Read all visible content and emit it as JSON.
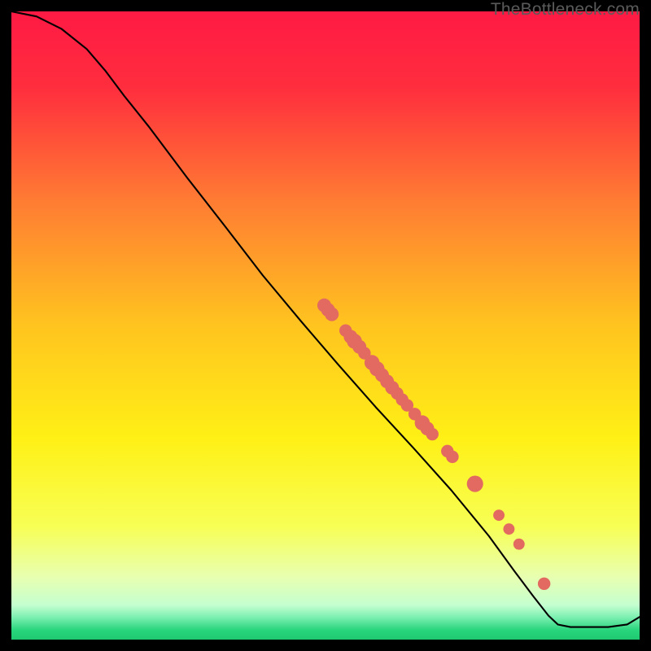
{
  "watermark": "TheBottleneck.com",
  "chart_data": {
    "type": "line",
    "title": "",
    "xlabel": "",
    "ylabel": "",
    "xlim": [
      0,
      100
    ],
    "ylim": [
      0,
      100
    ],
    "gradient_stops": [
      {
        "offset": 0.0,
        "color": "#ff1a44"
      },
      {
        "offset": 0.12,
        "color": "#ff2d3e"
      },
      {
        "offset": 0.3,
        "color": "#ff7b33"
      },
      {
        "offset": 0.5,
        "color": "#ffc41f"
      },
      {
        "offset": 0.68,
        "color": "#fff016"
      },
      {
        "offset": 0.82,
        "color": "#f7ff55"
      },
      {
        "offset": 0.9,
        "color": "#e8ffb0"
      },
      {
        "offset": 0.945,
        "color": "#c5ffd0"
      },
      {
        "offset": 0.965,
        "color": "#7aefb0"
      },
      {
        "offset": 0.985,
        "color": "#28d47c"
      },
      {
        "offset": 1.0,
        "color": "#1ec972"
      }
    ],
    "curve": [
      {
        "x": 0,
        "y": 100
      },
      {
        "x": 4,
        "y": 99.2
      },
      {
        "x": 8,
        "y": 97.2
      },
      {
        "x": 12,
        "y": 94
      },
      {
        "x": 15,
        "y": 90.5
      },
      {
        "x": 18,
        "y": 86.5
      },
      {
        "x": 22,
        "y": 81.5
      },
      {
        "x": 28,
        "y": 73.5
      },
      {
        "x": 34,
        "y": 65.8
      },
      {
        "x": 40,
        "y": 58
      },
      {
        "x": 46,
        "y": 50.8
      },
      {
        "x": 52,
        "y": 43.8
      },
      {
        "x": 58,
        "y": 37.0
      },
      {
        "x": 64,
        "y": 30.5
      },
      {
        "x": 70,
        "y": 23.8
      },
      {
        "x": 76,
        "y": 16.5
      },
      {
        "x": 80,
        "y": 11.0
      },
      {
        "x": 83,
        "y": 7.0
      },
      {
        "x": 85.5,
        "y": 3.8
      },
      {
        "x": 87,
        "y": 2.4
      },
      {
        "x": 89,
        "y": 2.0
      },
      {
        "x": 95,
        "y": 2.0
      },
      {
        "x": 98,
        "y": 2.4
      },
      {
        "x": 100,
        "y": 3.6
      }
    ],
    "markers": [
      {
        "x": 49.8,
        "y": 53.2,
        "r": 1.1
      },
      {
        "x": 50.4,
        "y": 52.5,
        "r": 1.1
      },
      {
        "x": 51.0,
        "y": 51.8,
        "r": 1.1
      },
      {
        "x": 53.2,
        "y": 49.2,
        "r": 1.0
      },
      {
        "x": 54.0,
        "y": 48.2,
        "r": 1.1
      },
      {
        "x": 54.6,
        "y": 47.5,
        "r": 1.2
      },
      {
        "x": 55.4,
        "y": 46.6,
        "r": 1.1
      },
      {
        "x": 56.2,
        "y": 45.6,
        "r": 1.0
      },
      {
        "x": 57.4,
        "y": 44.1,
        "r": 1.2
      },
      {
        "x": 58.2,
        "y": 43.1,
        "r": 1.2
      },
      {
        "x": 59.0,
        "y": 42.1,
        "r": 1.1
      },
      {
        "x": 59.8,
        "y": 41.1,
        "r": 1.1
      },
      {
        "x": 60.6,
        "y": 40.1,
        "r": 1.1
      },
      {
        "x": 61.4,
        "y": 39.2,
        "r": 1.0
      },
      {
        "x": 62.2,
        "y": 38.2,
        "r": 1.0
      },
      {
        "x": 63.0,
        "y": 37.3,
        "r": 1.0
      },
      {
        "x": 64.2,
        "y": 35.9,
        "r": 1.0
      },
      {
        "x": 65.4,
        "y": 34.5,
        "r": 1.2
      },
      {
        "x": 66.2,
        "y": 33.6,
        "r": 1.1
      },
      {
        "x": 67.0,
        "y": 32.7,
        "r": 1.0
      },
      {
        "x": 69.4,
        "y": 30.0,
        "r": 1.0
      },
      {
        "x": 70.2,
        "y": 29.1,
        "r": 1.0
      },
      {
        "x": 73.8,
        "y": 24.8,
        "r": 1.3
      },
      {
        "x": 77.6,
        "y": 19.8,
        "r": 0.9
      },
      {
        "x": 79.2,
        "y": 17.6,
        "r": 0.9
      },
      {
        "x": 80.8,
        "y": 15.2,
        "r": 0.9
      },
      {
        "x": 84.8,
        "y": 8.9,
        "r": 1.0
      }
    ],
    "marker_color": "#e26a60",
    "curve_color": "#000000",
    "curve_width": 2.1
  }
}
